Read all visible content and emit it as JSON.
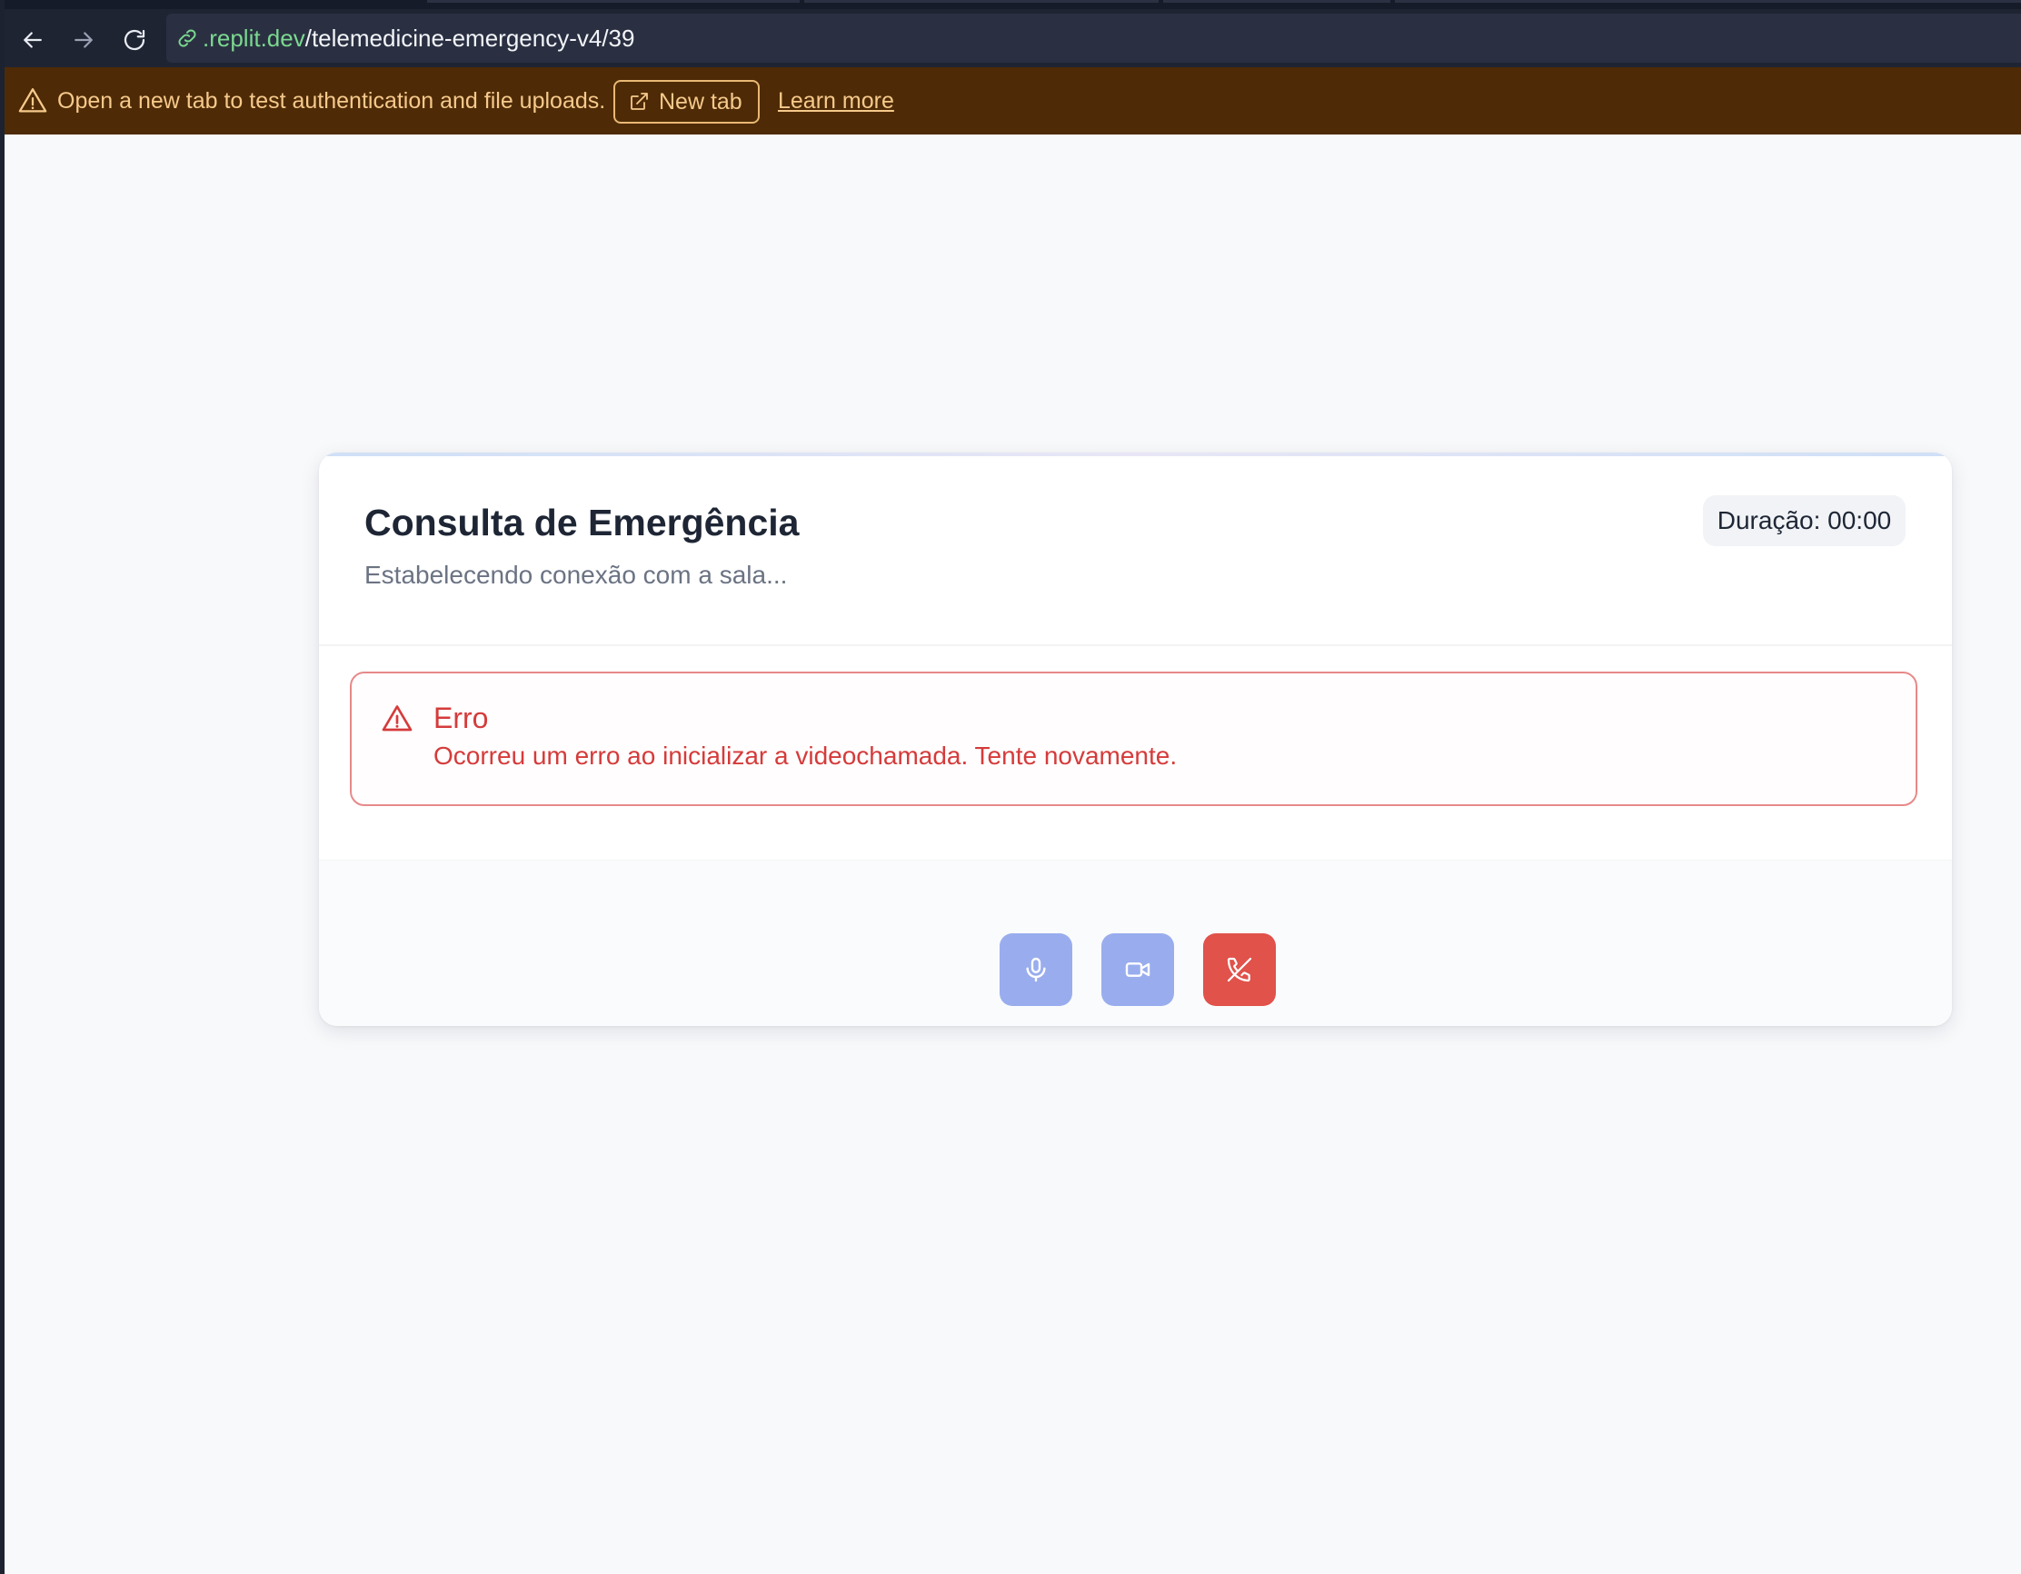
{
  "browser": {
    "url_domain": ".replit.dev",
    "url_path": "/telemedicine-emergency-v4/39"
  },
  "banner": {
    "message": "Open a new tab to test authentication and file uploads.",
    "new_tab_label": "New tab",
    "learn_more_label": "Learn more"
  },
  "consultation": {
    "title": "Consulta de Emergência",
    "subtitle": "Estabelecendo conexão com a sala...",
    "duration": "Duração: 00:00"
  },
  "error": {
    "title": "Erro",
    "message": "Ocorreu um erro ao inicializar a videochamada. Tente novamente."
  },
  "controls": {
    "icons": [
      "microphone-icon",
      "video-camera-icon",
      "phone-off-icon"
    ]
  },
  "colors": {
    "banner_bg": "#4e2b06",
    "banner_text": "#f6c98c",
    "error_red": "#d53b3b",
    "control_blue": "#99adee",
    "end_call_red": "#e0524a",
    "url_domain_green": "#7bd88f"
  }
}
